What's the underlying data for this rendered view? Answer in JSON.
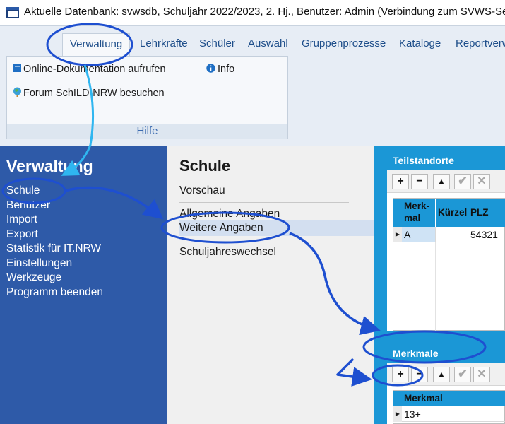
{
  "window": {
    "title": "Aktuelle Datenbank: svwsdb, Schuljahr 2022/2023, 2. Hj., Benutzer: Admin (Verbindung zum SVWS-Server"
  },
  "ribbon": {
    "tabs": [
      {
        "label": "Verwaltung",
        "active": true
      },
      {
        "label": "Lehrkräfte"
      },
      {
        "label": "Schüler"
      },
      {
        "label": "Auswahl"
      },
      {
        "label": "Gruppenprozesse"
      },
      {
        "label": "Kataloge"
      },
      {
        "label": "Reportverw"
      }
    ],
    "group": {
      "label": "Hilfe",
      "buttons": {
        "online_doc": "Online-Dokumentation aufrufen",
        "info": "Info",
        "forum": "Forum SchILD-NRW besuchen"
      }
    }
  },
  "sidebar": {
    "title": "Verwaltung",
    "items": [
      "Schule",
      "Benutzer",
      "Import",
      "Export",
      "Statistik für IT.NRW",
      "Einstellungen",
      "Werkzeuge",
      "Programm beenden"
    ]
  },
  "middle": {
    "title": "Schule",
    "items": [
      "Vorschau",
      "Allgemeine Angaben",
      "Weitere Angaben",
      "Schuljahreswechsel"
    ],
    "selected": "Weitere Angaben"
  },
  "teilstandorte": {
    "title": "Teilstandorte",
    "toolbar": {
      "add": "+",
      "remove": "−",
      "up": "▲",
      "ok": "✔",
      "cancel": "✕"
    },
    "columns": [
      "Merk-mal",
      "Kürzel",
      "PLZ"
    ],
    "rows": [
      {
        "merkmal": "A",
        "kuerzel": "",
        "plz": "54321"
      }
    ]
  },
  "merkmale": {
    "title": "Merkmale",
    "toolbar": {
      "add": "+",
      "remove": "−",
      "up": "▲",
      "ok": "✔",
      "cancel": "✕"
    },
    "columns": [
      "Merkmal"
    ],
    "rows": [
      {
        "merkmal": "13+"
      }
    ]
  },
  "colors": {
    "sidebar": "#2e5aa8",
    "accent": "#1b97d6",
    "annotation": "#1e4fd0",
    "annotation_light": "#2fb6f0"
  }
}
